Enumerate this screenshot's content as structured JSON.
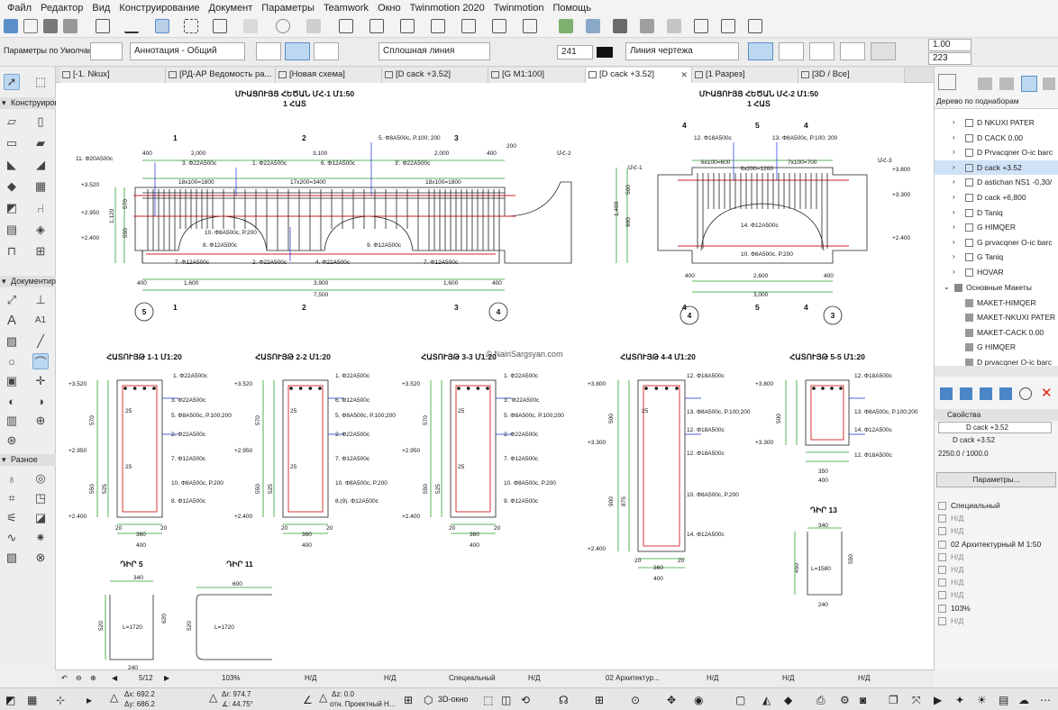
{
  "menu": [
    "Файл",
    "Редактор",
    "Вид",
    "Конструирование",
    "Документ",
    "Параметры",
    "Teamwork",
    "Окно",
    "Twinmotion 2020",
    "Twinmotion",
    "Помощь"
  ],
  "infobox": {
    "layer": "Параметры по Умолчанию",
    "annotation": "Аннотация - Общий",
    "linetype": "Сплошная линия",
    "pen": "241",
    "category": "Линия чертежа",
    "value_a": "1.00",
    "value_b": "223"
  },
  "tabs": [
    {
      "label": "[-1. Nkux]"
    },
    {
      "label": "[РД-АР Ведомость ра..."
    },
    {
      "label": "[Новая схема]"
    },
    {
      "label": "[D cack +3.52]"
    },
    {
      "label": "[G M1:100]"
    },
    {
      "label": "[D cack +3.52]"
    },
    {
      "label": "[1 Разрез]"
    },
    {
      "label": "[3D / Все]"
    }
  ],
  "toolbox": {
    "sections": [
      "Конструиров",
      "Документиро",
      "Разное"
    ],
    "text_tool": "A",
    "label_tool": "A1"
  },
  "navigator": {
    "header": "Дерево по поднаборам",
    "items": [
      {
        "label": "D NKUXI PATER"
      },
      {
        "label": "D CACK 0.00"
      },
      {
        "label": "D Prvacqner O-ic barc"
      },
      {
        "label": "D cack +3.52"
      },
      {
        "label": "D astichan NS1 -0,30/"
      },
      {
        "label": "D cack +6,800"
      },
      {
        "label": "D Taniq"
      },
      {
        "label": "G HIMQER"
      },
      {
        "label": "G prvacqner O-ic barc"
      },
      {
        "label": "G Taniq"
      },
      {
        "label": "HOVAR"
      }
    ],
    "layouts_folder": "Основные Макеты",
    "layouts": [
      {
        "label": "MAKET-HIMQER"
      },
      {
        "label": "MAKET-NKUXI PATER"
      },
      {
        "label": "MAKET-CACK 0.00"
      },
      {
        "label": "G HIMQER"
      },
      {
        "label": "D prvacqner O-ic barc"
      }
    ],
    "props_header": "Свойства",
    "prop_name": "D cack +3.52",
    "prop_view": "D cack +3.52",
    "prop_scale": "2250.0 / 1000.0",
    "params_button": "Параметры...",
    "params": [
      {
        "label": "Специальный"
      },
      {
        "label": "Н/Д"
      },
      {
        "label": "Н/Д"
      },
      {
        "label": "02 Архитектурный М 1:50"
      },
      {
        "label": "Н/Д"
      },
      {
        "label": "Н/Д"
      },
      {
        "label": "Н/Д"
      },
      {
        "label": "Н/Д"
      },
      {
        "label": "103%"
      },
      {
        "label": "Н/Д"
      }
    ]
  },
  "drawing": {
    "beam1_title": "ՄԻԱՑՈՒՅՑ ՀԵԾԱՆ ՄՀ-1 Մ1:50",
    "beam1_count": "1 ՀԱՏ",
    "beam2_title": "ՄԻԱՑՈՒՅՑ ՀԵԾԱՆ ՄՀ-2 Մ1:50",
    "beam2_count": "1 ՀԱՏ",
    "watermark": "© NairiSargsyan.com",
    "sections": [
      {
        "title": "ՀԱՏՈՒՅԹ 1-1 Մ1:20"
      },
      {
        "title": "ՀԱՏՈՒՅԹ 2-2 Մ1:20"
      },
      {
        "title": "ՀԱՏՈՒՅԹ 3-3 Մ1:20"
      },
      {
        "title": "ՀԱՏՈՒՅԹ 4-4 Մ1:20"
      },
      {
        "title": "ՀԱՏՈՒՅԹ 5-5 Մ1:20"
      }
    ],
    "details": [
      {
        "title": "ԴԻՐ 5",
        "length": "L=1720"
      },
      {
        "title": "ԴԻՐ 11",
        "length": "L=1720"
      },
      {
        "title": "ԴԻՐ 13",
        "length": "L=1580"
      }
    ],
    "b1_top_dims": [
      "400",
      "2,000",
      "3,100",
      "2,000",
      "400",
      "200"
    ],
    "b1_spacing": [
      "18x100=1800",
      "17x200=3400",
      "18x100=1800"
    ],
    "b1_bottom_dims": [
      "400",
      "1,600",
      "3,900",
      "1,600",
      "400"
    ],
    "b1_total": "7,500",
    "b1_levels": [
      "+3.520",
      "+2.950",
      "+2.400"
    ],
    "b1_vert_dims": [
      "570",
      "550",
      "1,120"
    ],
    "b1_sections": [
      "1",
      "2",
      "3"
    ],
    "b1_axes": [
      "5",
      "4"
    ],
    "b1_labels": [
      "11. Φ20A500c",
      "3. Φ22A500c",
      "1. Φ22A500c",
      "6. Φ12A500c",
      "5. Φ8A500c, P.100; 200",
      "3'. Φ22A500c",
      "10. Φ8A500c, P.200",
      "8. Φ12A500c",
      "9. Φ12A500c",
      "7. Φ12A500c",
      "2. Φ22A500c",
      "4. Φ22A500c",
      "7. Φ12A500c"
    ],
    "b1_arm": "ՄՀ-2",
    "b2_top_dims": [
      "6x100=600",
      "6x200=1200",
      "7x100=700"
    ],
    "b2_bottom_dims": [
      "400",
      "2,600",
      "400"
    ],
    "b2_total": "3,000",
    "b2_levels": [
      "+3.800",
      "+3.300",
      "+2.400"
    ],
    "b2_vert_dims": [
      "500",
      "900",
      "1,400"
    ],
    "b2_sections": [
      "4",
      "5",
      "4"
    ],
    "b2_axes": [
      "4",
      "3"
    ],
    "b2_arms": [
      "ՄՀ-1",
      "ՄՀ-3"
    ],
    "b2_labels": [
      "12. Φ18A500c",
      "13. Φ8A500c, P.100; 200",
      "14. Φ12A500c",
      "10. Φ8A500c, P.200"
    ],
    "sec1_labels": [
      "1. Φ22A500c",
      "3. Φ22A500c",
      "5. Φ8A500c, P.100;200",
      "2. Φ22A500c",
      "7. Φ12A500c",
      "10. Φ8A500c, P.200",
      "8. Φ12A500c"
    ],
    "sec2_labels": [
      "1. Φ22A500c",
      "6. Φ12A500c",
      "5. Φ8A500c, P.100;200",
      "2. Φ22A500c",
      "7. Φ12A500c",
      "10. Φ8A500c, P.200",
      "8.(9). Φ12A500c"
    ],
    "sec3_labels": [
      "1. Φ22A500c",
      "3'. Φ22A500c",
      "5. Φ8A500c, P.100;200",
      "2. Φ22A500c",
      "7. Φ12A500c",
      "10. Φ8A500c, P.200",
      "9. Φ12A500c"
    ],
    "sec4_labels": [
      "12. Φ18A500c",
      "13. Φ8A500c, P.100;200",
      "12. Φ18A500c",
      "12. Φ18A500c",
      "10. Φ8A500c, P.200",
      "14. Φ12A500c"
    ],
    "sec5_labels": [
      "12. Φ18A500c",
      "13. Φ8A500c, P.100;200",
      "14. Φ12A500c",
      "12. Φ18A500c"
    ],
    "sec_levels_a": [
      "+3.520",
      "+2.950",
      "+2.400"
    ],
    "sec_levels_b": [
      "+3.800",
      "+3.300",
      "+2.400"
    ],
    "sec_dims_a": [
      "570",
      "550",
      "525",
      "25",
      "25"
    ],
    "sec_dims_b": [
      "500",
      "900",
      "875",
      "25"
    ],
    "sec_width": [
      "20",
      "360",
      "20",
      "400"
    ],
    "sec5_width": [
      "350",
      "400"
    ],
    "d5_dims": [
      "340",
      "520",
      "620",
      "240"
    ],
    "d11_dims": [
      "600",
      "520"
    ],
    "d13_dims": [
      "340",
      "450",
      "550",
      "240"
    ]
  },
  "status": {
    "page": "5/12",
    "zoom": "103%",
    "nd": "Н/Д",
    "special": "Специальный",
    "arch": "02 Архитектур..."
  },
  "coords": {
    "dx": "Δx: 692.2",
    "dy": "Δy: 686.2",
    "ar": "Δr: 974.7",
    "aa": "∡: 44.75°",
    "dz": "Δz: 0.0",
    "rel": "отн. Проектный Н...",
    "view3d": "3D-окно"
  }
}
